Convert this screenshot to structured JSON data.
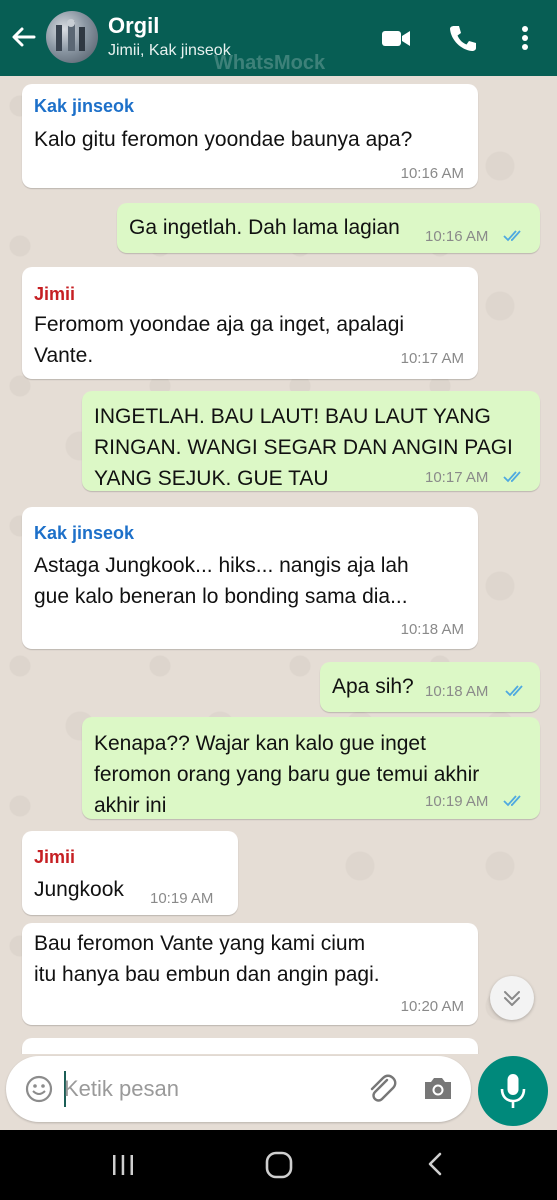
{
  "header": {
    "title": "Orgil",
    "subtitle": "Jimii, Kak jinseok",
    "watermark": "WhatsMock"
  },
  "colors": {
    "header": "#075e54",
    "incoming": "#ffffff",
    "outgoing": "#dcf8c6",
    "sender_jinseok": "#1d70c9",
    "sender_jimii": "#c61f23",
    "tick": "#4fa9e0",
    "mic": "#00897b"
  },
  "messages": [
    {
      "sender": "Kak jinseok",
      "text": "Kalo gitu feromon yoondae baunya apa?",
      "time": "10:16 AM"
    },
    {
      "text": "Ga ingetlah. Dah lama lagian",
      "time": "10:16 AM"
    },
    {
      "sender": "Jimii",
      "text": "Feromom yoondae aja ga inget, apalagi\nVante.",
      "time": "10:17 AM"
    },
    {
      "text": "INGETLAH. BAU LAUT! BAU LAUT YANG\nRINGAN. WANGI SEGAR DAN ANGIN PAGI\nYANG SEJUK. GUE TAU",
      "time": "10:17 AM"
    },
    {
      "sender": "Kak jinseok",
      "text": "Astaga Jungkook... hiks... nangis aja lah\ngue kalo beneran lo bonding sama dia...",
      "time": "10:18 AM"
    },
    {
      "text": "Apa sih?",
      "time": "10:18 AM"
    },
    {
      "text": "Kenapa?? Wajar kan kalo gue inget\nferomon orang yang baru gue temui akhir\nakhir ini",
      "time": "10:19 AM"
    },
    {
      "sender": "Jimii",
      "text": "Jungkook",
      "time": "10:19 AM"
    },
    {
      "text": "Bau feromon Vante yang kami cium\nitu hanya bau embun dan angin pagi.",
      "time": "10:20 AM"
    }
  ],
  "input": {
    "placeholder": "Ketik pesan"
  }
}
